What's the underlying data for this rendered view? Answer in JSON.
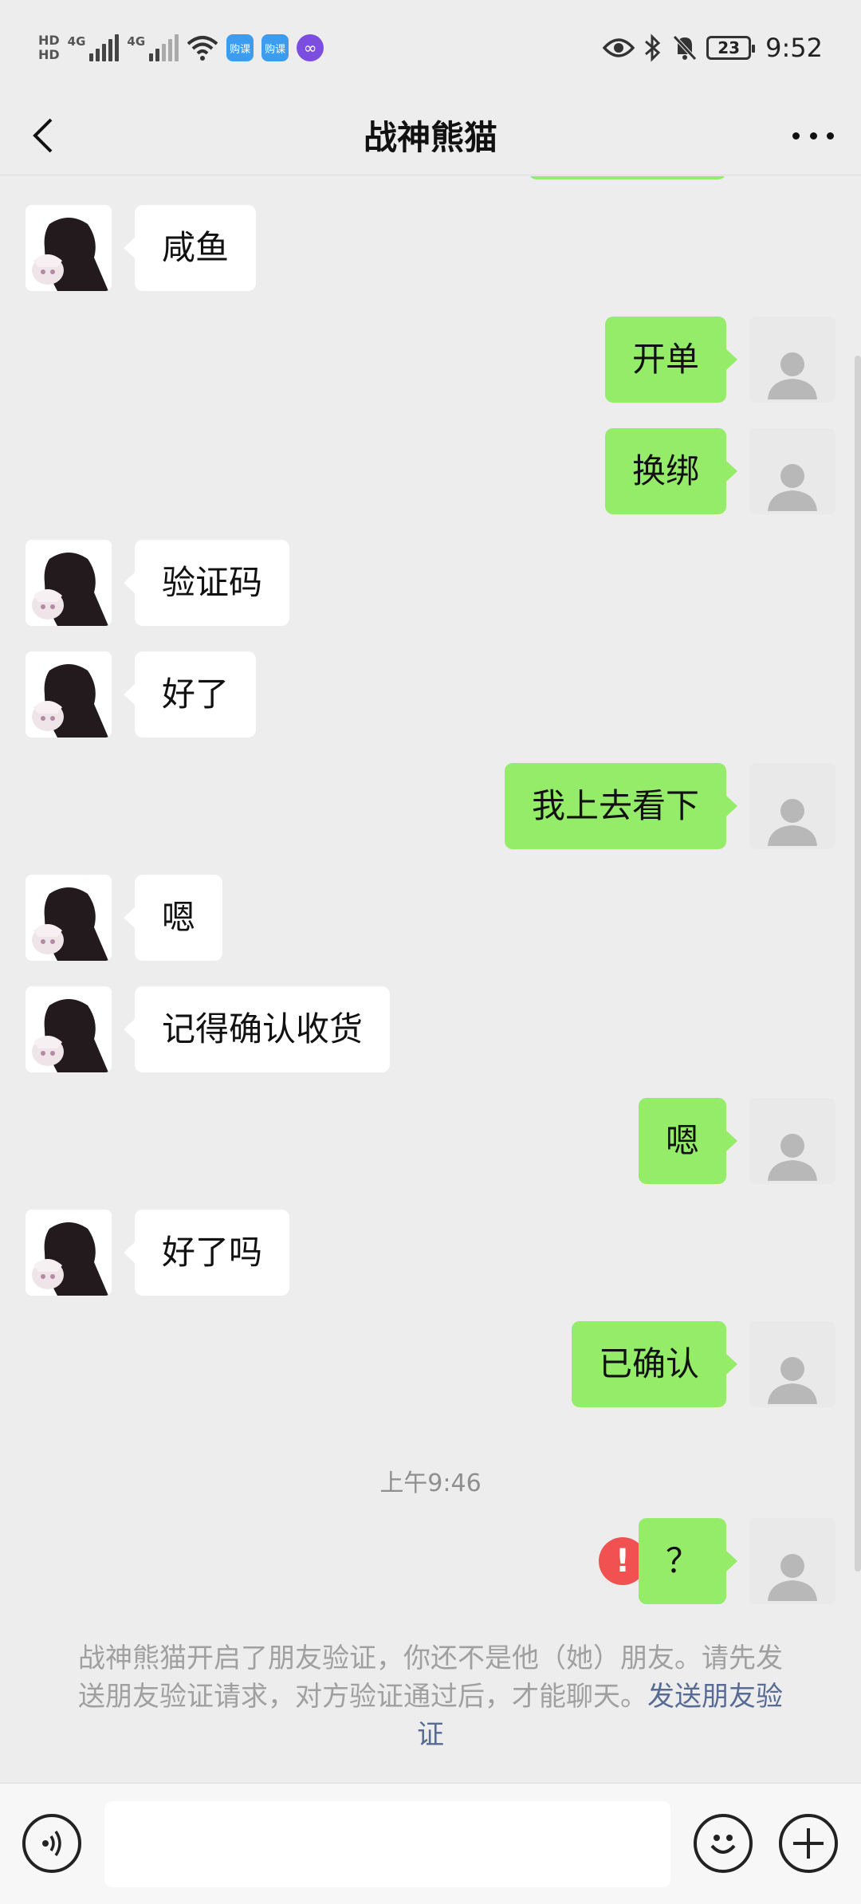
{
  "status_bar": {
    "hd_1": "HD",
    "hd_2": "HD",
    "net_1": "4G",
    "net_2": "4G",
    "app_badge_1": "购课",
    "app_badge_2": "购课",
    "battery": "23",
    "time": "9:52"
  },
  "header": {
    "title": "战神熊猫"
  },
  "messages": [
    {
      "side": "peer",
      "text": "咸鱼"
    },
    {
      "side": "me",
      "text": "开单"
    },
    {
      "side": "me",
      "text": "换绑"
    },
    {
      "side": "peer",
      "text": "验证码"
    },
    {
      "side": "peer",
      "text": "好了"
    },
    {
      "side": "me",
      "text": "我上去看下"
    },
    {
      "side": "peer",
      "text": "嗯"
    },
    {
      "side": "peer",
      "text": "记得确认收货"
    },
    {
      "side": "me",
      "text": "嗯"
    },
    {
      "side": "peer",
      "text": "好了吗"
    },
    {
      "side": "me",
      "text": "已确认"
    },
    {
      "side": "me",
      "text": "？",
      "failed": true
    }
  ],
  "time_separator": "上午9:46",
  "failed_badge": "!",
  "notice": {
    "text": "战神熊猫开启了朋友验证，你还不是他（她）朋友。请先发送朋友验证请求，对方验证通过后，才能聊天。",
    "link": "发送朋友验证"
  },
  "input_bar": {
    "placeholder": ""
  }
}
